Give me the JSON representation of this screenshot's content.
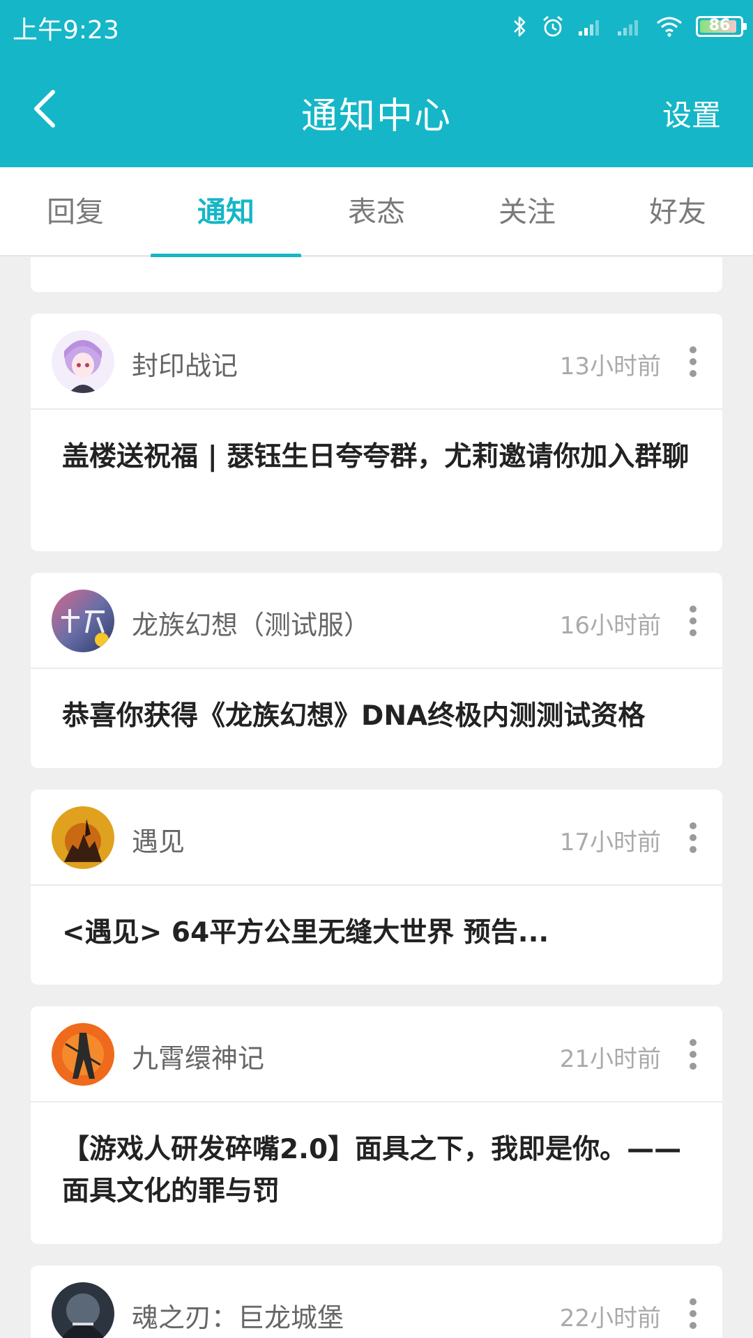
{
  "status_bar": {
    "time": "上午9:23",
    "battery": "86",
    "icons": [
      "bluetooth-icon",
      "alarm-icon",
      "signal-icon",
      "signal-icon",
      "wifi-icon",
      "battery-icon"
    ]
  },
  "header": {
    "title": "通知中心",
    "settings_label": "设置",
    "back_icon": "chevron-left-icon",
    "color": "#15b6c7"
  },
  "tabs": [
    {
      "label": "回复",
      "active": false
    },
    {
      "label": "通知",
      "active": true
    },
    {
      "label": "表态",
      "active": false
    },
    {
      "label": "关注",
      "active": false
    },
    {
      "label": "好友",
      "active": false
    }
  ],
  "notifications": [
    {
      "source": "封印战记",
      "time": "13小时前",
      "content": "盖楼送祝福 | 瑟钰生日夸夸群，尤莉邀请你加入群聊"
    },
    {
      "source": "龙族幻想（测试服）",
      "time": "16小时前",
      "content": "恭喜你获得《龙族幻想》DNA终极内测测试资格"
    },
    {
      "source": "遇见",
      "time": "17小时前",
      "content": "<遇见> 64平方公里无缝大世界 预告..."
    },
    {
      "source": "九霄缳神记",
      "time": "21小时前",
      "content": "【游戏人研发碎嘴2.0】面具之下，我即是你。——面具文化的罪与罚"
    },
    {
      "source": "魂之刃：巨龙城堡",
      "time": "22小时前",
      "content": ""
    }
  ]
}
